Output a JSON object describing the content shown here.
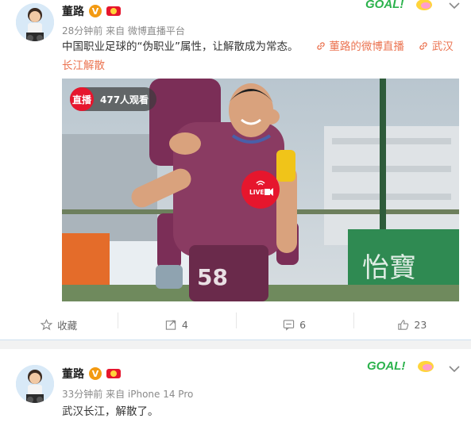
{
  "posts": [
    {
      "author": "董路",
      "verified_badge": "V",
      "meta": "28分钟前 来自 微博直播平台",
      "text_main": "中国职业足球的“伪职业”属性，让解散成为常态。",
      "link_live": "董路的微博直播",
      "link_topic_1": "武汉",
      "link_topic_2": "长江解散",
      "live_tag": "直播",
      "live_viewers": "477人观看",
      "live_button": "LIVE",
      "goal_badge": "GOAL!",
      "actions": {
        "favorite": "收藏",
        "repost": "4",
        "comment": "6",
        "like": "23"
      }
    },
    {
      "author": "董路",
      "verified_badge": "V",
      "meta": "33分钟前 来自 iPhone 14 Pro",
      "text": "武汉长江，解散了。",
      "goal_badge": "GOAL!"
    }
  ],
  "colors": {
    "link": "#eb7350",
    "live_red": "#e6162d",
    "goal_green": "#2bb24c",
    "verified": "#f39a12"
  },
  "icons": [
    "chevron-down-icon",
    "star-icon",
    "repost-icon",
    "comment-icon",
    "like-icon",
    "link-icon",
    "broadcast-icon",
    "medal-icon"
  ]
}
